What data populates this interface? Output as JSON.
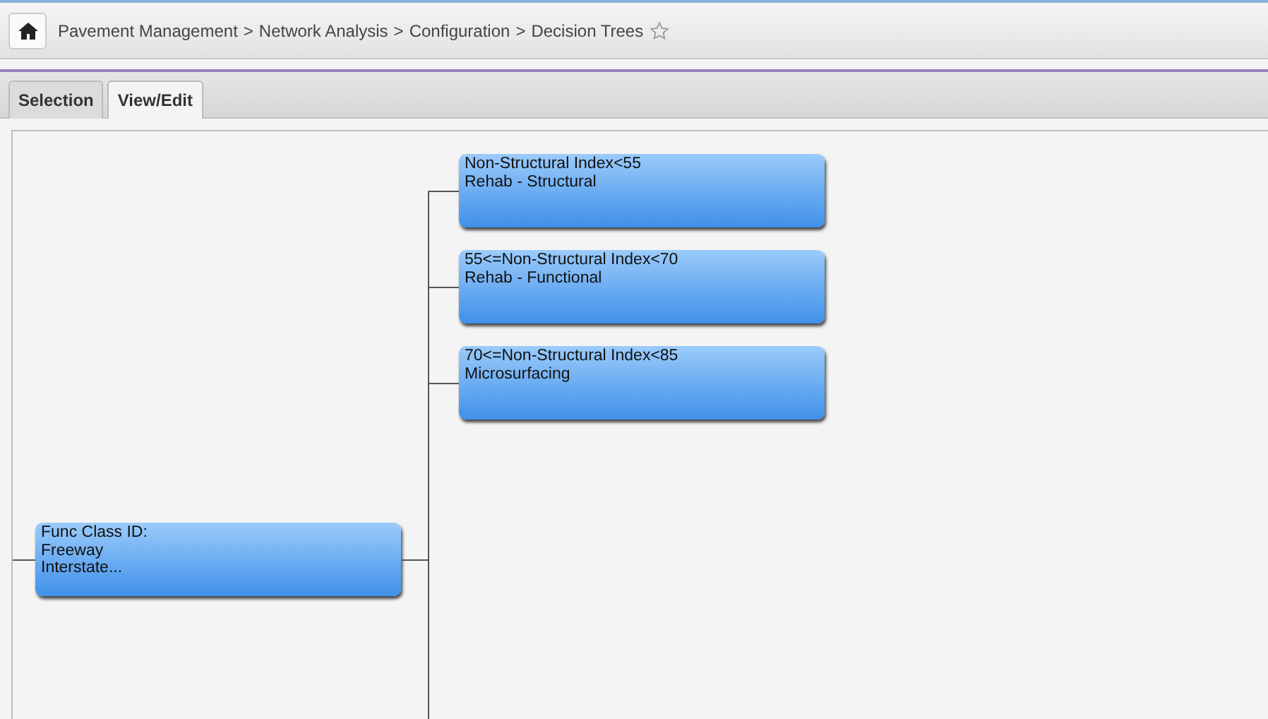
{
  "breadcrumb": {
    "items": [
      "Pavement Management",
      "Network Analysis",
      "Configuration",
      "Decision Trees"
    ],
    "separator": ">",
    "favorite": false
  },
  "tabs": [
    {
      "label": "Selection",
      "selected": false
    },
    {
      "label": "View/Edit",
      "selected": true
    }
  ],
  "tree": {
    "lines": [
      "Func Class ID:",
      "Freeway",
      "Interstate..."
    ],
    "children": [
      {
        "lines": [
          "Non-Structural Index<55",
          "Rehab - Structural"
        ]
      },
      {
        "lines": [
          "55<=Non-Structural Index<70",
          "Rehab - Functional"
        ]
      },
      {
        "lines": [
          "70<=Non-Structural Index<85",
          "Microsurfacing"
        ]
      }
    ]
  }
}
